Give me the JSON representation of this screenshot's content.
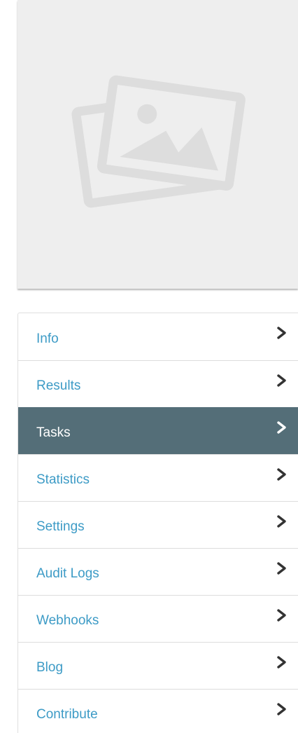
{
  "placeholder_image": {
    "icon": "image-placeholder-icon",
    "background": "#eeeeee",
    "icon_color": "#dddddd"
  },
  "menu": {
    "items": [
      {
        "label": "Info",
        "active": false
      },
      {
        "label": "Results",
        "active": false
      },
      {
        "label": "Tasks",
        "active": true
      },
      {
        "label": "Statistics",
        "active": false
      },
      {
        "label": "Settings",
        "active": false
      },
      {
        "label": "Audit Logs",
        "active": false
      },
      {
        "label": "Webhooks",
        "active": false
      },
      {
        "label": "Blog",
        "active": false
      },
      {
        "label": "Contribute",
        "active": false
      }
    ],
    "item_icon": "chevron-right-icon",
    "link_color": "#3d9bc6",
    "active_background": "#546e78",
    "active_text_color": "#ffffff",
    "chevron_color": "#333333"
  }
}
